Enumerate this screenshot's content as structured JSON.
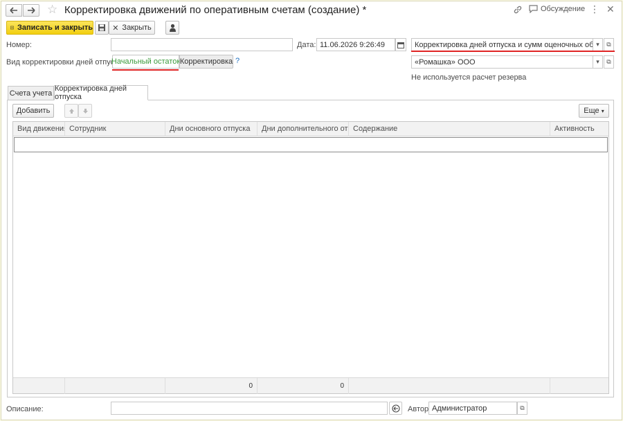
{
  "title": "Корректировка движений по оперативным счетам (создание) *",
  "header": {
    "discussion_label": "Обсуждение"
  },
  "toolbar": {
    "save_close_label": "Записать и закрыть",
    "close_label": "Закрыть"
  },
  "form": {
    "number_label": "Номер:",
    "number_value": "",
    "date_label": "Дата:",
    "date_value": "11.06.2026  9:26:49",
    "operation_type_value": "Корректировка дней отпуска и сумм оценочных обязательств",
    "organization_value": "«Ромашка» ООО",
    "reserve_note": "Не используется расчет резерва",
    "adjust_kind_label": "Вид корректировки  дней отпуска:",
    "adjust_kind_options": [
      "Начальный остаток",
      "Корректировка"
    ],
    "adjust_kind_selected": "Начальный остаток",
    "help_label": "?"
  },
  "tabs": [
    "Счета учета",
    "Корректировка дней отпуска"
  ],
  "active_tab": "Корректировка дней отпуска",
  "table_toolbar": {
    "add_label": "Добавить",
    "more_label": "Еще"
  },
  "table": {
    "columns": [
      "Вид движения",
      "Сотрудник",
      "Дни основного отпуска",
      "Дни дополнительного отп...",
      "Содержание",
      "Активность"
    ],
    "rows": [],
    "footer": [
      "",
      "",
      "0",
      "0",
      "",
      ""
    ]
  },
  "bottom": {
    "description_label": "Описание:",
    "description_value": "",
    "author_label": "Автор:",
    "author_value": "Администратор"
  },
  "colors": {
    "accent_yellow": "#f5d30d",
    "selected_green": "#3a9a3a",
    "highlight_red": "#e02424",
    "link_blue": "#1d6fc0"
  }
}
